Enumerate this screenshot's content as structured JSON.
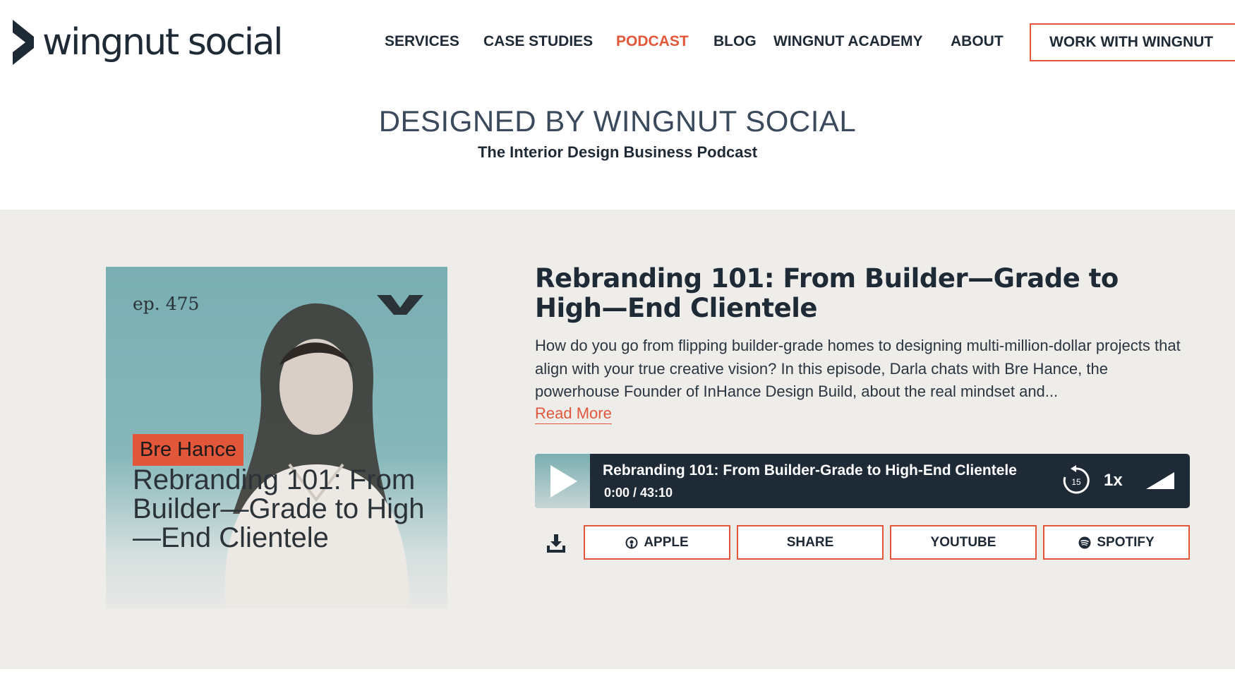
{
  "header": {
    "logo_text": "wingnut social",
    "nav": [
      {
        "label": "SERVICES",
        "active": false
      },
      {
        "label": "CASE STUDIES",
        "active": false
      },
      {
        "label": "PODCAST",
        "active": true
      },
      {
        "label": "BLOG",
        "active": false
      },
      {
        "label": "WINGNUT ACADEMY",
        "active": false
      },
      {
        "label": "ABOUT",
        "active": false
      }
    ],
    "cta_label": "WORK WITH WINGNUT"
  },
  "hero": {
    "title": "DESIGNED BY WINGNUT SOCIAL",
    "subtitle": "The Interior Design Business Podcast"
  },
  "episode": {
    "cover": {
      "episode_number": "ep. 475",
      "guest_name": "Bre Hance",
      "title": "Rebranding 101: From Builder—Grade to High—End Clientele"
    },
    "title": "Rebranding 101: From Builder—Grade to High—End Clientele",
    "description": "How do you go from flipping builder-grade homes to designing multi-million-dollar projects that align with your true creative vision? In this episode, Darla chats with Bre Hance, the powerhouse Founder of InHance Design Build, about the real mindset and...",
    "read_more": "Read More",
    "player": {
      "title": "Rebranding 101: From Builder-Grade to High-End Clientele",
      "time": "0:00 / 43:10",
      "skip_seconds": "15",
      "speed": "1x"
    },
    "buttons": {
      "apple": "APPLE",
      "share": "SHARE",
      "youtube": "YOUTUBE",
      "spotify": "SPOTIFY"
    }
  },
  "colors": {
    "accent": "#e2563a",
    "dark": "#1f2a37",
    "section_bg": "#eeedea"
  }
}
